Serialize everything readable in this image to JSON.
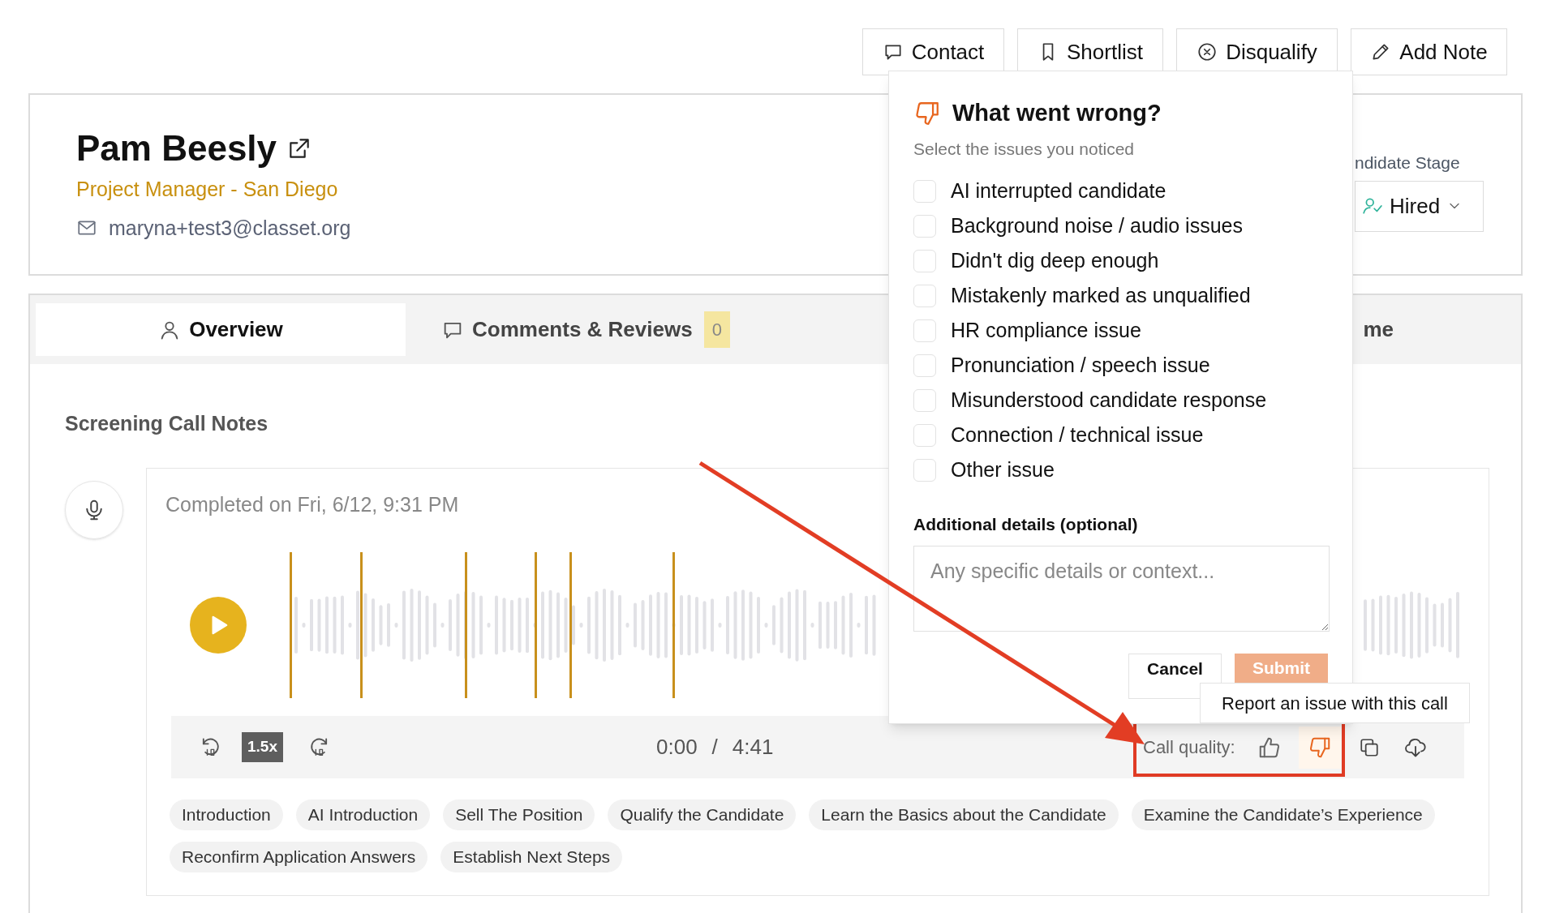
{
  "actions": [
    {
      "kind": "contact",
      "label": "Contact"
    },
    {
      "kind": "shortlist",
      "label": "Shortlist"
    },
    {
      "kind": "disqualify",
      "label": "Disqualify"
    },
    {
      "kind": "note",
      "label": "Add Note"
    }
  ],
  "candidate": {
    "name": "Pam Beesly",
    "role": "Project Manager - San Diego",
    "email": "maryna+test3@classet.org"
  },
  "stage": {
    "label": "ndidate Stage",
    "value": "Hired"
  },
  "tabs": [
    {
      "kind": "person",
      "label": "Overview",
      "selected": true
    },
    {
      "kind": "comment",
      "label": "Comments & Reviews",
      "badge": "0",
      "selected": false
    },
    {
      "kind": "plain",
      "label": "me",
      "selected": false
    }
  ],
  "section_title": "Screening Call Notes",
  "call": {
    "completed": "Completed on Fri, 6/12, 9:31 PM",
    "speed": "1.5x",
    "current_time": "0:00",
    "separator": "/",
    "duration": "4:41",
    "quality_label": "Call quality:",
    "quality": [
      {
        "kind": "up",
        "selected": false
      },
      {
        "kind": "down",
        "selected": true
      }
    ]
  },
  "chapters": [
    "Introduction",
    "AI Introduction",
    "Sell The Position",
    "Qualify the Candidate",
    "Learn the Basics about the Candidate",
    "Examine the Candidate’s Experience",
    "Reconfirm Application Answers",
    "Establish Next Steps"
  ],
  "popover": {
    "title": "What went wrong?",
    "subtitle": "Select the issues you noticed",
    "issues": [
      {
        "label": "AI interrupted candidate",
        "checked": false
      },
      {
        "label": "Background noise / audio issues",
        "checked": false
      },
      {
        "label": "Didn't dig deep enough",
        "checked": false
      },
      {
        "label": "Mistakenly marked as unqualified",
        "checked": false
      },
      {
        "label": "HR compliance issue",
        "checked": false
      },
      {
        "label": "Pronunciation / speech issue",
        "checked": false
      },
      {
        "label": "Misunderstood candidate response",
        "checked": false
      },
      {
        "label": "Connection / technical issue",
        "checked": false
      },
      {
        "label": "Other issue",
        "checked": false
      }
    ],
    "details_label": "Additional details (optional)",
    "placeholder": "Any specific details or context...",
    "buttons": [
      {
        "kind": "cancel",
        "label": "Cancel",
        "disabled": false
      },
      {
        "kind": "submit",
        "label": "Submit",
        "disabled": true
      }
    ]
  },
  "tooltip": "Report an issue with this call"
}
